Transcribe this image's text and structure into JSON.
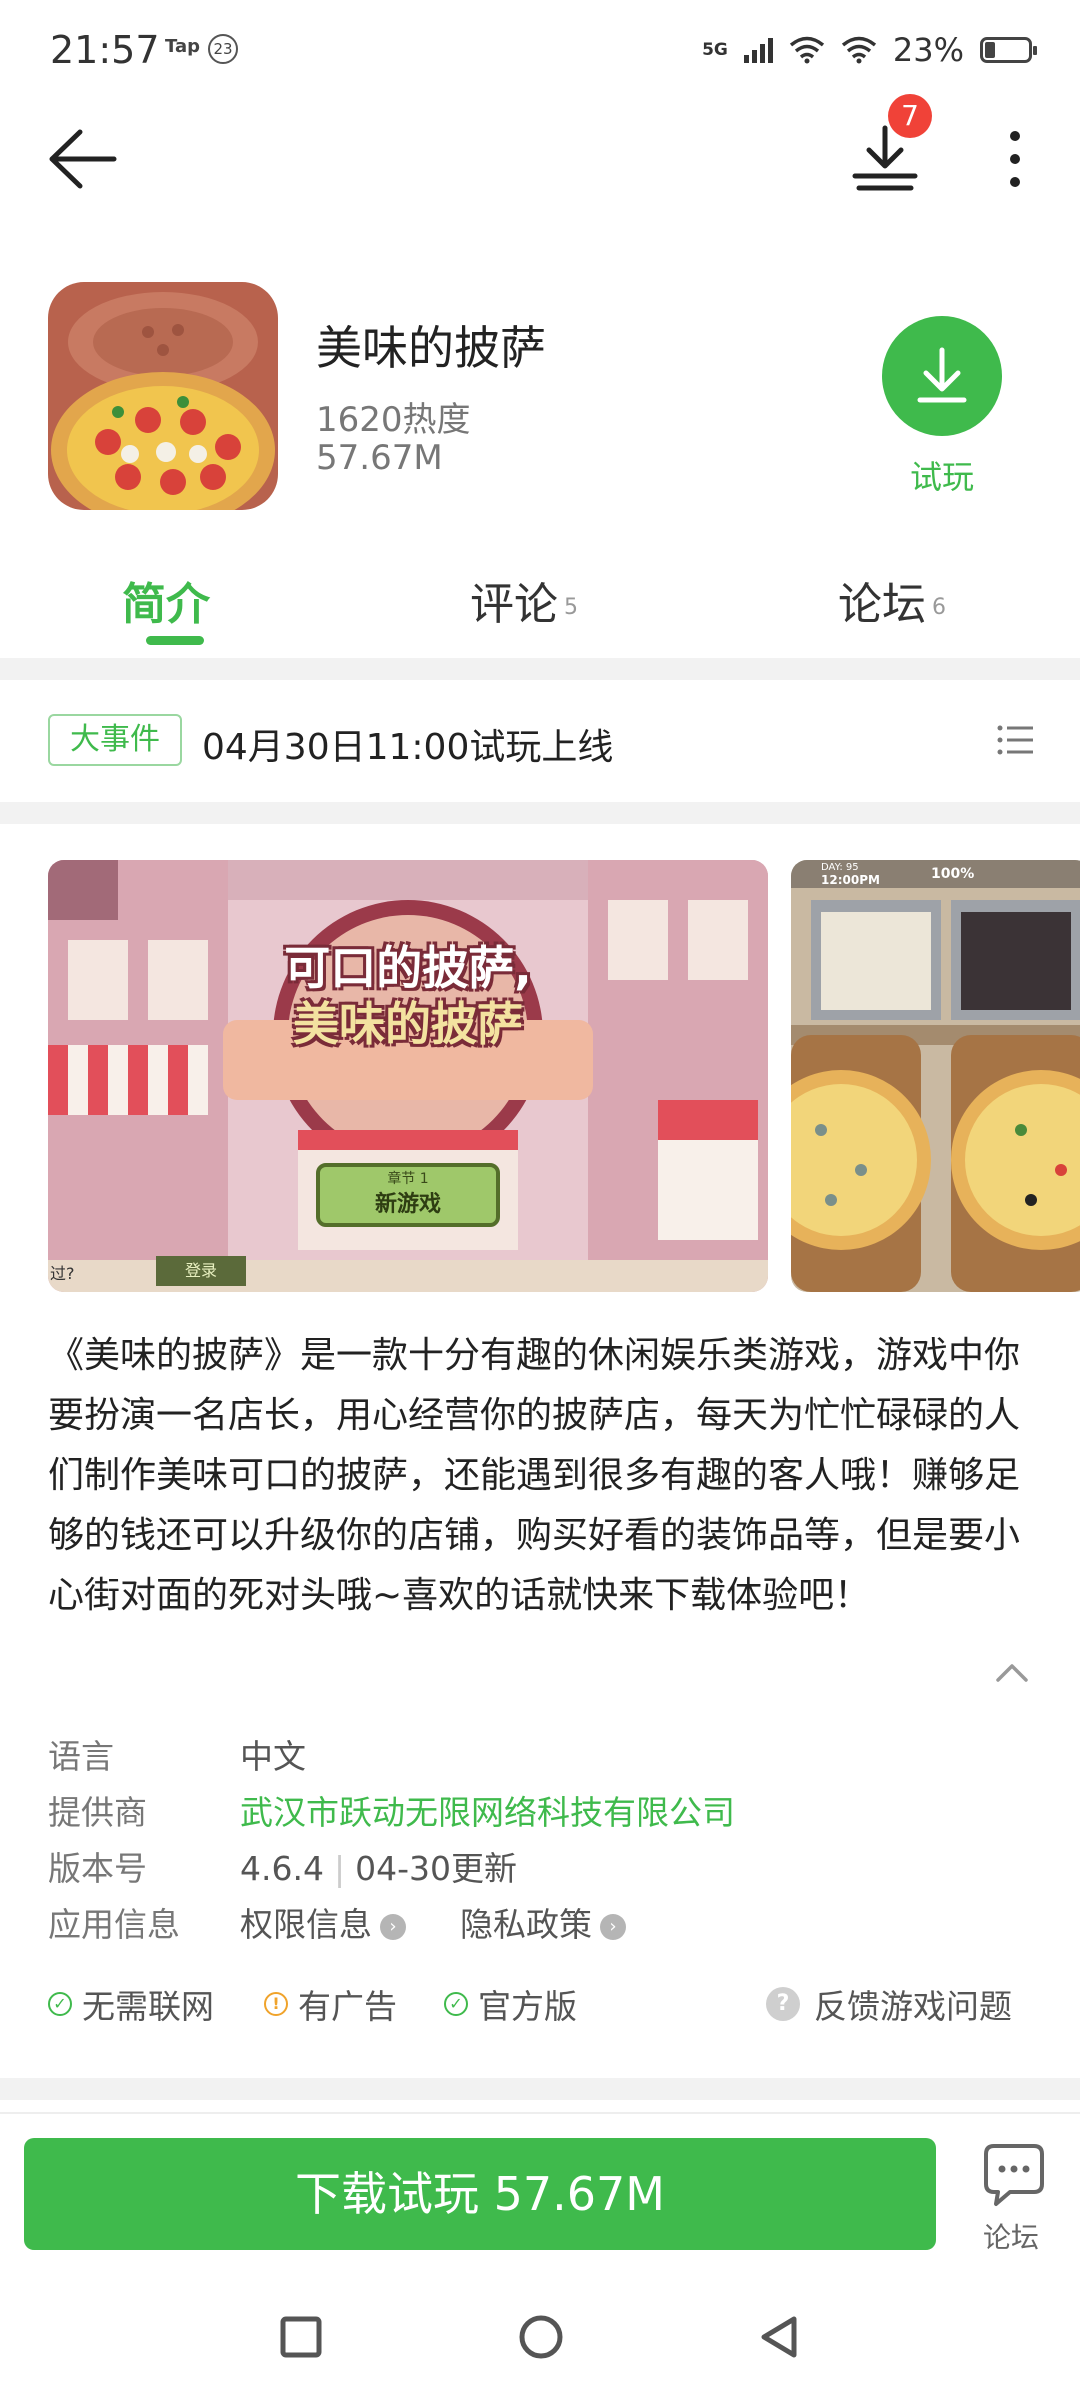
{
  "status_bar": {
    "time": "21:57",
    "tap_label": "Tap",
    "notif_badge": "23",
    "network": "5G",
    "battery": "23%",
    "battery_level": 0.23
  },
  "top_nav": {
    "download_count": "7"
  },
  "app": {
    "name": "美味的披萨",
    "heat": "1620热度",
    "size": "57.67M",
    "trial_label": "试玩"
  },
  "tabs": [
    {
      "label": "简介",
      "count": ""
    },
    {
      "label": "评论",
      "count": "5"
    },
    {
      "label": "论坛",
      "count": "6"
    }
  ],
  "event": {
    "tag": "大事件",
    "text": "04月30日11:00试玩上线"
  },
  "screenshots": {
    "shot1_title_line1": "可口的披萨,",
    "shot1_title_line2": "美味的披萨",
    "shot1_chapter": "章节 1",
    "shot1_button": "新游戏",
    "shot1_login": "登录",
    "shot1_corner": "过?",
    "shot2_day": "DAY: 95",
    "shot2_time": "12:00PM",
    "shot2_percent": "100%"
  },
  "description": "《美味的披萨》是一款十分有趣的休闲娱乐类游戏，游戏中你要扮演一名店长，用心经营你的披萨店，每天为忙忙碌碌的人们制作美味可口的披萨，还能遇到很多有趣的客人哦！赚够足够的钱还可以升级你的店铺，购买好看的装饰品等，但是要小心街对面的死对头哦~喜欢的话就快来下载体验吧！",
  "info": {
    "language_label": "语言",
    "language_value": "中文",
    "provider_label": "提供商",
    "provider_value": "武汉市跃动无限网络科技有限公司",
    "version_label": "版本号",
    "version_value": "4.6.4",
    "update_value": "04-30更新",
    "appinfo_label": "应用信息",
    "permission_link": "权限信息",
    "privacy_link": "隐私政策"
  },
  "badges": {
    "no_network": "无需联网",
    "has_ads": "有广告",
    "official": "官方版",
    "feedback": "反馈游戏问题"
  },
  "bottom": {
    "download_label": "下载试玩 57.67M",
    "forum_label": "论坛"
  },
  "colors": {
    "accent": "#3fba4c",
    "badge_red": "#f04238",
    "warn": "#f0a32b"
  }
}
